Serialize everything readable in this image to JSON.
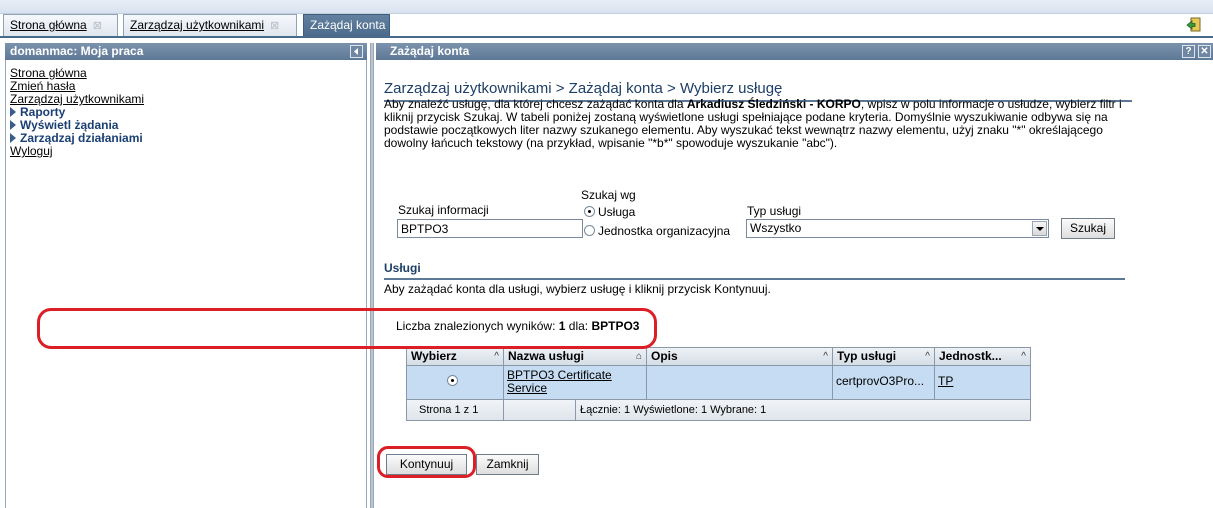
{
  "tabs": [
    {
      "label": "Strona główna",
      "close": "⊠"
    },
    {
      "label": "Zarządzaj użytkownikami",
      "close": "⊠"
    },
    {
      "label": "Zażądaj konta",
      "close": "✕"
    }
  ],
  "left_panel": {
    "title": "domanmac: Moja praca",
    "items": [
      {
        "label": "Strona główna"
      },
      {
        "label": "Zmień hasła"
      },
      {
        "label": "Zarządzaj użytkownikami"
      },
      {
        "label": "Raporty"
      },
      {
        "label": "Wyświetl żądania"
      },
      {
        "label": "Zarządzaj działaniami"
      },
      {
        "label": "Wyloguj"
      }
    ]
  },
  "right_panel": {
    "title": "Zażądaj konta",
    "help": "?",
    "close": "✕"
  },
  "page": {
    "title": "Zarządzaj użytkownikami > Zażądaj konta > Wybierz usługę",
    "intro_1": "Aby znaleźć usługę, dla której chcesz zażądać konta dla ",
    "intro_bold": "Arkadiusz Śledziński - KORPO",
    "intro_2": ", wpisz w polu informacje o usłudze, wybierz filtr i kliknij przycisk Szukaj. W tabeli poniżej zostaną wyświetlone usługi spełniające podane kryteria. Domyślnie wyszukiwanie odbywa się na podstawie początkowych liter nazwy szukanego elementu. Aby wyszukać tekst wewnątrz nazwy elementu, użyj znaku \"*\" określającego dowolny łańcuch tekstowy (na przykład, wpisanie \"*b*\" spowoduje wyszukanie \"abc\")."
  },
  "search": {
    "info_label": "Szukaj informacji",
    "info_value": "BPTPO3",
    "by_label": "Szukaj wg",
    "radio_service": "Usługa",
    "radio_org": "Jednostka organizacyjna",
    "type_label": "Typ usługi",
    "type_value": "Wszystko",
    "search_button": "Szukaj"
  },
  "services": {
    "section_title": "Usługi",
    "description": "Aby zażądać konta dla usługi, wybierz usługę i kliknij przycisk Kontynuuj.",
    "results_prefix": "Liczba znalezionych wyników: ",
    "results_count": "1",
    "results_mid": " dla: ",
    "results_query": "BPTPO3"
  },
  "table": {
    "headers": [
      "Wybierz",
      "Nazwa usługi",
      "Opis",
      "Typ usługi",
      "Jednostk..."
    ],
    "sort_icons": [
      "^",
      "⌂",
      "^",
      "^",
      "^"
    ],
    "row": {
      "name_line1": "BPTPO3 Certificate",
      "name_line2": "Service",
      "description": "",
      "type": "certprovO3Pro...",
      "unit": "TP"
    },
    "footer": {
      "page": "Strona 1 z 1",
      "totals": "Łącznie: 1  Wyświetlone: 1  Wybrane: 1"
    }
  },
  "buttons": {
    "continue": "Kontynuuj",
    "close": "Zamknij"
  },
  "colors": {
    "header_blue": "#5d7896",
    "selected_row": "#c6dcf2",
    "annotation_red": "#dc1f26"
  }
}
